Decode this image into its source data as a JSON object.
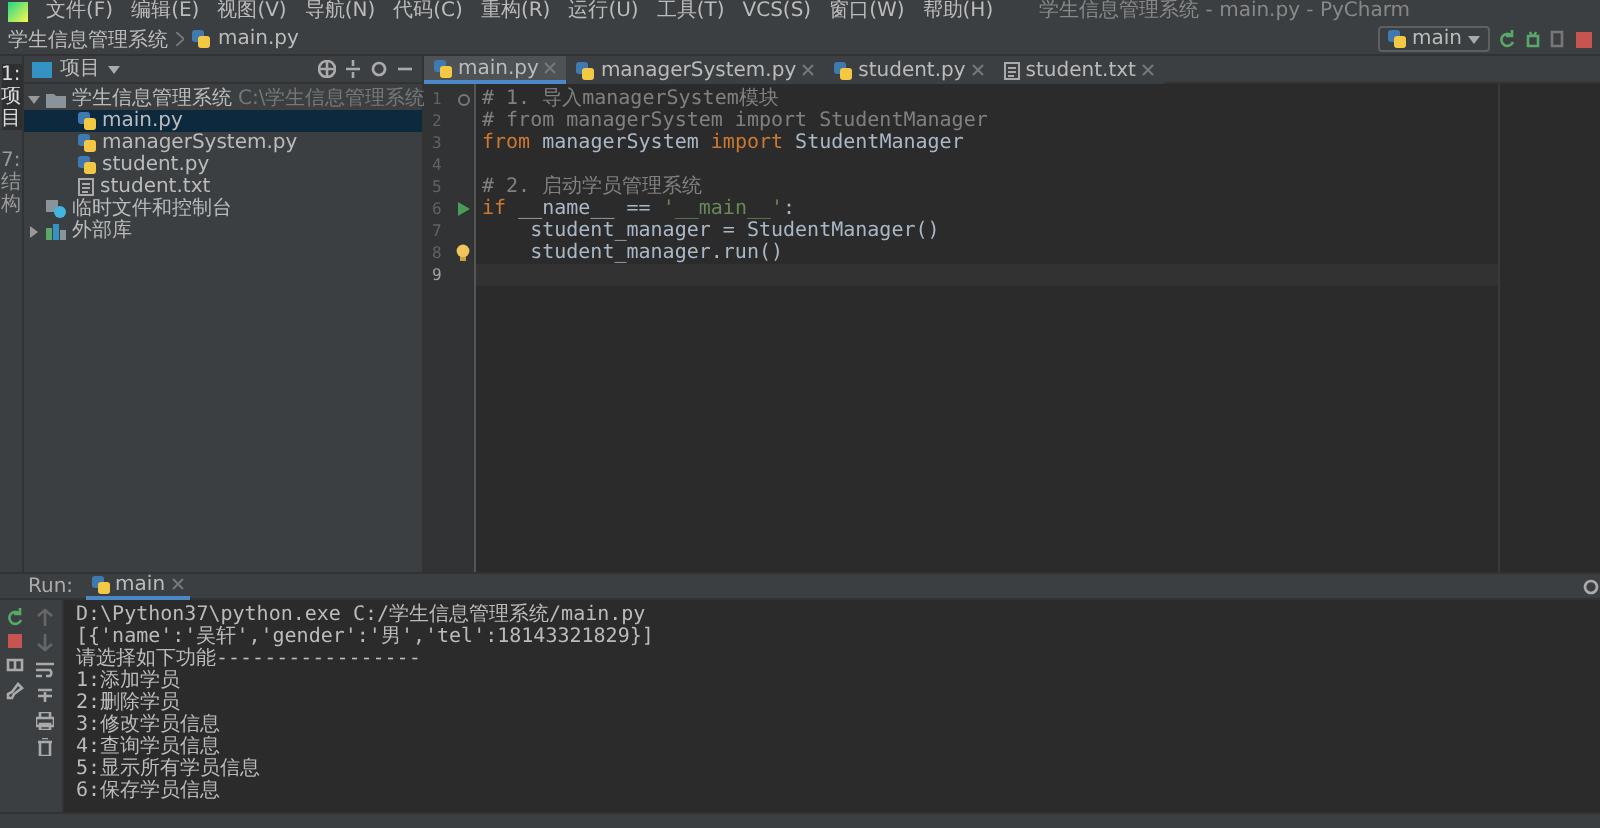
{
  "menu": [
    "文件(F)",
    "编辑(E)",
    "视图(V)",
    "导航(N)",
    "代码(C)",
    "重构(R)",
    "运行(U)",
    "工具(T)",
    "VCS(S)",
    "窗口(W)",
    "帮助(H)"
  ],
  "window": {
    "title": "学生信息管理系统 - main.py - PyCharm"
  },
  "breadcrumb": [
    "学生信息管理系统",
    "main.py"
  ],
  "run_config": {
    "label": "main"
  },
  "left_strip": [
    "1: 项目",
    "7: 结构"
  ],
  "project_panel": {
    "title": "项目",
    "tree": [
      {
        "label": "学生信息管理系统",
        "path": "C:\\学生信息管理系统",
        "kind": "folder",
        "expanded": true,
        "selected": false,
        "children": [
          {
            "label": "main.py",
            "kind": "python",
            "selected": true
          },
          {
            "label": "managerSystem.py",
            "kind": "python",
            "selected": false
          },
          {
            "label": "student.py",
            "kind": "python",
            "selected": false
          },
          {
            "label": "student.txt",
            "kind": "text",
            "selected": false
          }
        ]
      },
      {
        "label": "临时文件和控制台",
        "kind": "scratch",
        "selected": false
      },
      {
        "label": "外部库",
        "kind": "library",
        "expanded": false,
        "selected": false
      }
    ]
  },
  "tabs": [
    {
      "label": "main.py",
      "kind": "python",
      "selected": true
    },
    {
      "label": "managerSystem.py",
      "kind": "python",
      "selected": false
    },
    {
      "label": "student.py",
      "kind": "python",
      "selected": false
    },
    {
      "label": "student.txt",
      "kind": "text",
      "selected": false
    }
  ],
  "code": [
    {
      "number": "1",
      "foldable": true,
      "runnable": false,
      "bulb": false,
      "current": false,
      "tokens": [
        {
          "kind": "comment",
          "text": "# 1. 导入managerSystem模块"
        }
      ]
    },
    {
      "number": "2",
      "foldable": false,
      "runnable": false,
      "bulb": false,
      "current": false,
      "tokens": [
        {
          "kind": "comment",
          "text": "# from managerSystem import StudentManager"
        }
      ]
    },
    {
      "number": "3",
      "foldable": false,
      "runnable": false,
      "bulb": false,
      "current": false,
      "tokens": [
        {
          "kind": "keyword",
          "text": "from"
        },
        {
          "kind": "plain",
          "text": " managerSystem "
        },
        {
          "kind": "keyword",
          "text": "import"
        },
        {
          "kind": "plain",
          "text": " StudentManager"
        }
      ]
    },
    {
      "number": "4",
      "foldable": false,
      "runnable": false,
      "bulb": false,
      "current": false
    },
    {
      "number": "5",
      "foldable": false,
      "runnable": false,
      "bulb": false,
      "current": false,
      "tokens": [
        {
          "kind": "comment",
          "text": "# 2. 启动学员管理系统"
        }
      ]
    },
    {
      "number": "6",
      "foldable": false,
      "runnable": true,
      "bulb": false,
      "current": false,
      "tokens": [
        {
          "kind": "keyword",
          "text": "if"
        },
        {
          "kind": "plain",
          "text": " __name__ == "
        },
        {
          "kind": "string",
          "text": "'__main__'"
        },
        {
          "kind": "plain",
          "text": ":"
        }
      ]
    },
    {
      "number": "7",
      "foldable": false,
      "runnable": false,
      "bulb": false,
      "current": false,
      "tokens": [
        {
          "kind": "plain",
          "text": "    student_manager = StudentManager()"
        }
      ]
    },
    {
      "number": "8",
      "foldable": false,
      "runnable": false,
      "bulb": true,
      "current": false,
      "tokens": [
        {
          "kind": "plain",
          "text": "    student_manager.run()"
        }
      ]
    },
    {
      "number": "9",
      "foldable": false,
      "runnable": false,
      "bulb": false,
      "current": true
    }
  ],
  "run_panel": {
    "label": "Run:",
    "tab": "main",
    "output": [
      "D:\\Python37\\python.exe C:/学生信息管理系统/main.py",
      "[{'name':'吴轩','gender':'男','tel':18143321829}]",
      "请选择如下功能-----------------",
      "1:添加学员",
      "2:删除学员",
      "3:修改学员信息",
      "4:查询学员信息",
      "5:显示所有学员信息",
      "6:保存学员信息"
    ]
  }
}
